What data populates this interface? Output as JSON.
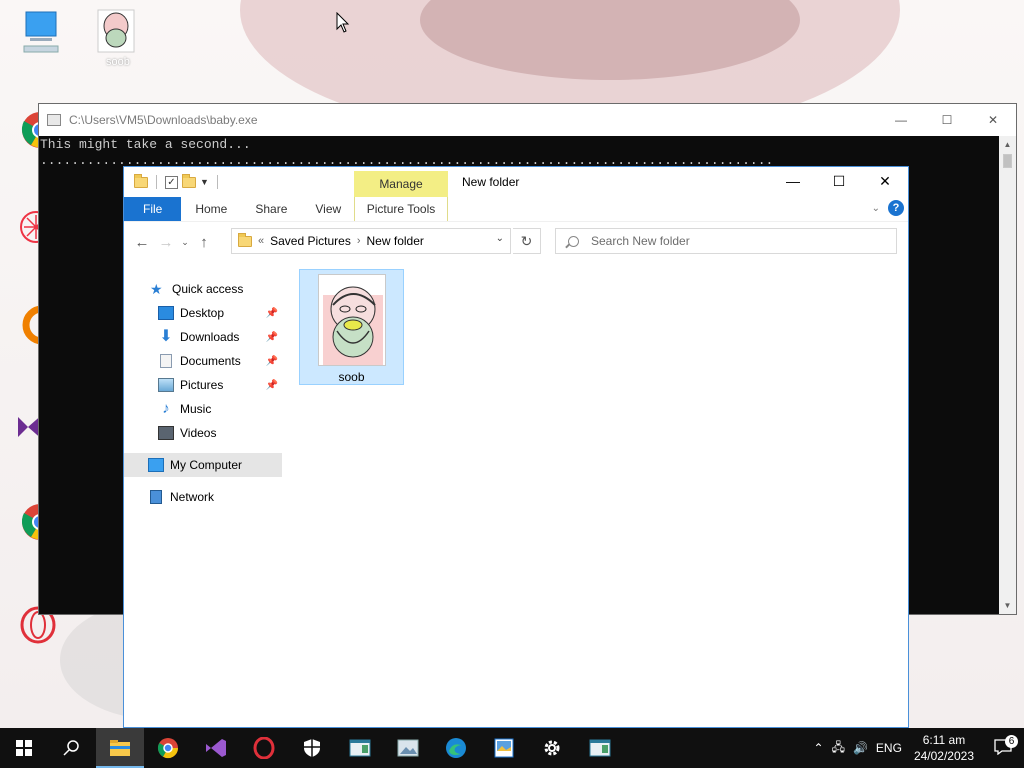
{
  "desktop": {
    "icons": [
      {
        "name": "this-pc"
      },
      {
        "name": "soob-image",
        "label": "soob"
      },
      {
        "name": "chrome-shortcut"
      },
      {
        "name": "app-shortcut-red"
      },
      {
        "name": "vlc-shortcut"
      },
      {
        "name": "visual-studio-shortcut"
      },
      {
        "name": "chrome-shortcut-2"
      },
      {
        "name": "opera-shortcut"
      }
    ]
  },
  "console": {
    "title": "C:\\Users\\VM5\\Downloads\\baby.exe",
    "lines": [
      "This might take a second...",
      ".............................................................................................."
    ]
  },
  "explorer": {
    "title": "New folder",
    "manage_tab": "Manage",
    "ribbon_tabs": [
      "File",
      "Home",
      "Share",
      "View"
    ],
    "picture_tools": "Picture Tools",
    "breadcrumbs": [
      "«",
      "Saved Pictures",
      "New folder"
    ],
    "search_placeholder": "Search New folder",
    "nav": {
      "quick_access": "Quick access",
      "items": [
        {
          "label": "Desktop",
          "pinned": true
        },
        {
          "label": "Downloads",
          "pinned": true
        },
        {
          "label": "Documents",
          "pinned": true
        },
        {
          "label": "Pictures",
          "pinned": true
        },
        {
          "label": "Music",
          "pinned": false
        },
        {
          "label": "Videos",
          "pinned": false
        }
      ],
      "my_computer": "My Computer",
      "network": "Network"
    },
    "files": [
      {
        "label": "soob",
        "selected": true
      }
    ]
  },
  "taskbar": {
    "apps": [
      "start",
      "search",
      "file-explorer",
      "chrome",
      "visual-studio",
      "opera",
      "security",
      "app",
      "photos",
      "edge",
      "image-viewer",
      "settings",
      "app-2"
    ],
    "tray": {
      "language": "ENG",
      "time": "6:11 am",
      "date": "24/02/2023",
      "notifications": "6"
    }
  },
  "colors": {
    "accent": "#1a73d0",
    "manage_tab": "#f3ee85",
    "selection": "#cce8ff",
    "console_bg": "#0c0c0c"
  }
}
